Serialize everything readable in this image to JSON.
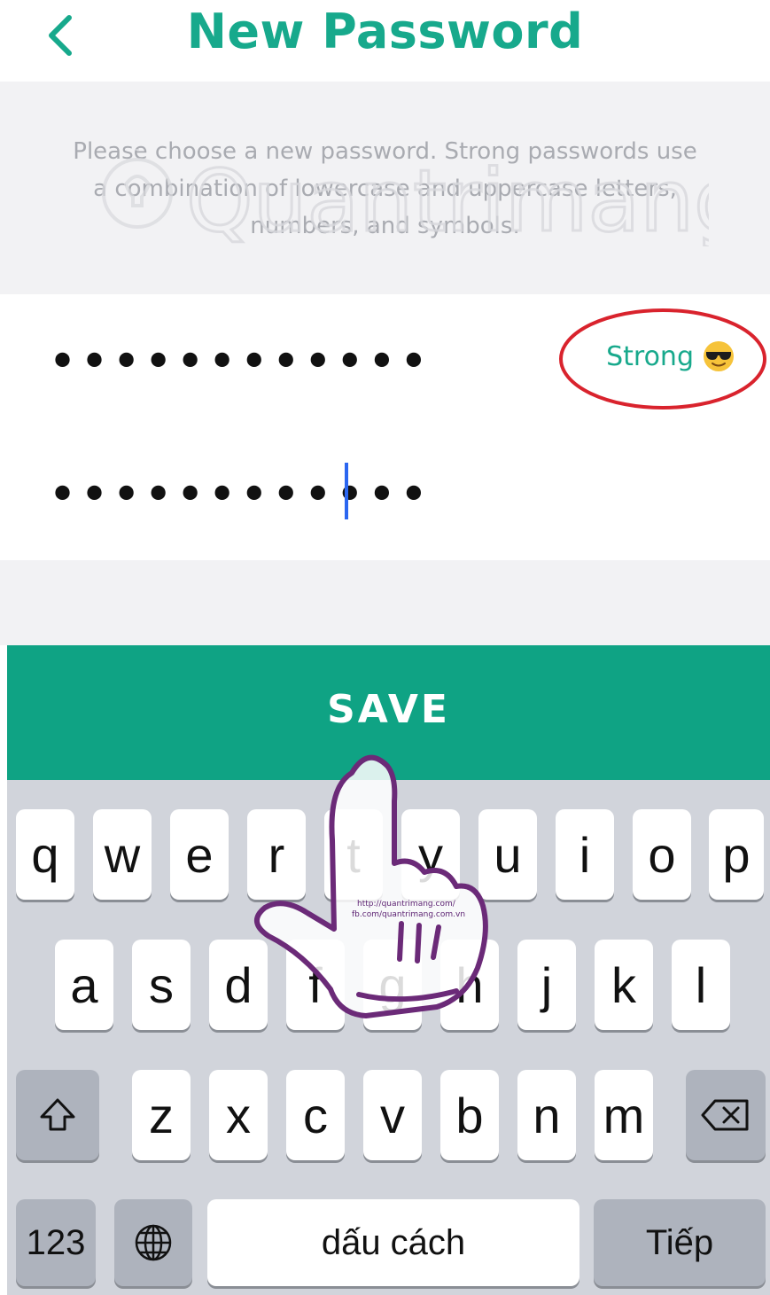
{
  "header": {
    "title": "New Password",
    "back_icon": "chevron-left-icon"
  },
  "info": {
    "text": "Please choose a new password. Strong passwords use a combination of lowercase and uppercase letters, numbers, and symbols.",
    "watermark": "Quantrimang"
  },
  "fields": {
    "password": {
      "value": "••••••••••••",
      "strength_label": "Strong",
      "strength_icon": "sunglasses-emoji-icon"
    },
    "confirm": {
      "value": "••••••••••••"
    }
  },
  "save_button": {
    "label": "SAVE"
  },
  "overlay": {
    "hand_icon": "pointing-hand-icon"
  },
  "keyboard": {
    "row1": [
      "q",
      "w",
      "e",
      "r",
      "t",
      "y",
      "u",
      "i",
      "o",
      "p"
    ],
    "row2": [
      "a",
      "s",
      "d",
      "f",
      "g",
      "h",
      "j",
      "k",
      "l"
    ],
    "row3": [
      "z",
      "x",
      "c",
      "v",
      "b",
      "n",
      "m"
    ],
    "shift_icon": "shift-icon",
    "delete_icon": "backspace-icon",
    "numbers_label": "123",
    "globe_icon": "globe-icon",
    "space_label": "dấu cách",
    "return_label": "Tiếp"
  },
  "colors": {
    "accent": "#17a98c",
    "save_bg": "#0fa384",
    "info_bg": "#f2f2f4",
    "keyboard_bg": "#d1d4db",
    "caret": "#2b66f0",
    "annotation_ring": "#d9232d",
    "hand_outline": "#6b2a78"
  }
}
